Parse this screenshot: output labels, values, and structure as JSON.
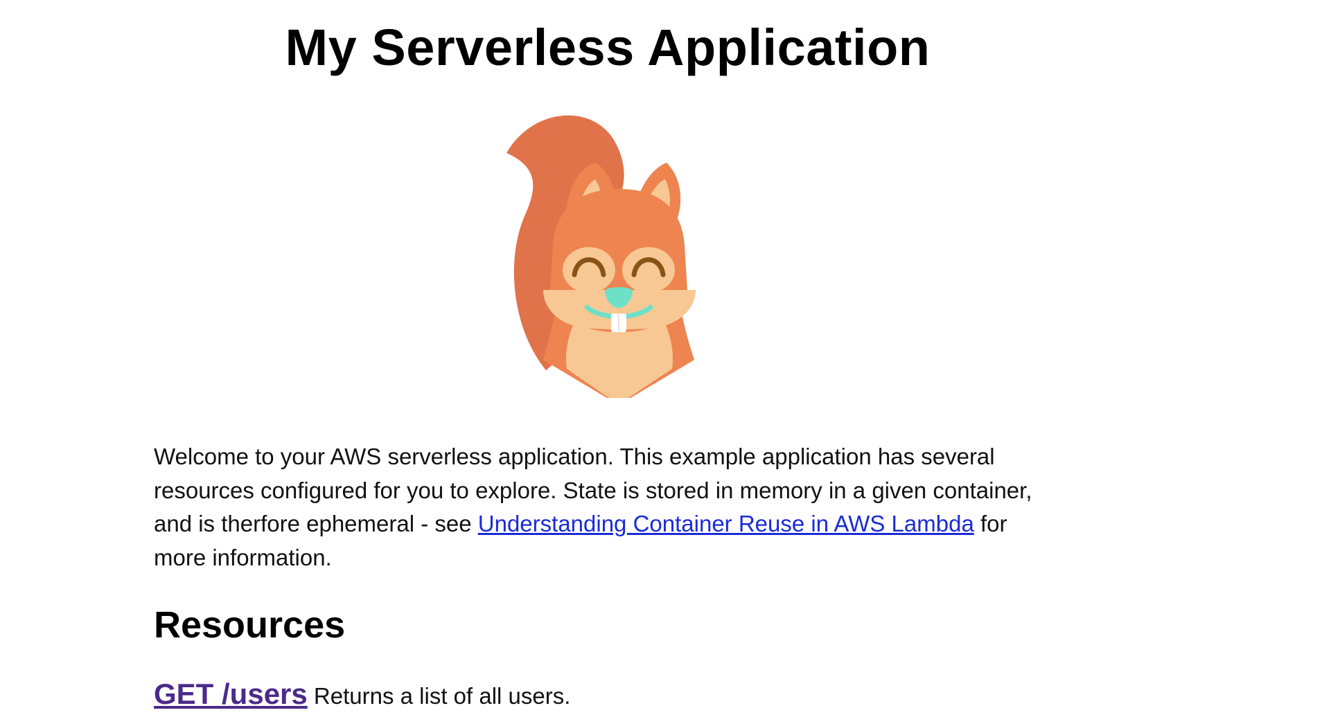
{
  "header": {
    "title": "My Serverless Application"
  },
  "mascot": {
    "icon": "squirrel-mascot-icon",
    "colors": {
      "fur": "#ee8450",
      "tail": "#e0734a",
      "face": "#f7c893",
      "inner_ear": "#f7c893",
      "nose_smile": "#6fe0c8",
      "eyes": "#8a5316",
      "teeth": "#ffffff"
    }
  },
  "intro": {
    "text_before_link": "Welcome to your AWS serverless application. This example application has several resources configured for you to explore. State is stored in memory in a given container, and is therfore ephemeral - see ",
    "link_text": "Understanding Container Reuse in AWS Lambda",
    "text_after_link": " for more information."
  },
  "resources": {
    "heading": "Resources",
    "items": [
      {
        "link_text": "GET /users",
        "description": " Returns a list of all users."
      }
    ]
  },
  "colors": {
    "link": "#1a2bd8",
    "visited_link": "#4b2a8a",
    "text": "#111111"
  }
}
